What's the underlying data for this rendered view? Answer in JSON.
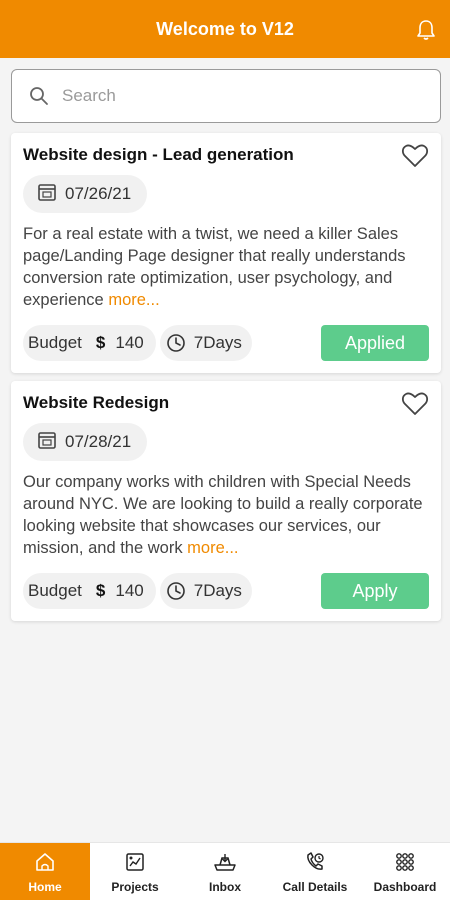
{
  "app": {
    "title": "Welcome to V12",
    "notification_icon": "bell-icon",
    "accent_color": "#f08a00",
    "success_color": "#5dcc8c"
  },
  "search": {
    "placeholder": "Search",
    "value": ""
  },
  "projects": [
    {
      "title": "Website design - Lead generation",
      "date": "07/26/21",
      "description": "For a real estate with a twist, we need a killer Sales page/Landing Page designer that really understands conversion rate optimization, user psychology, and experience",
      "more_label": "more...",
      "budget_label": "Budget",
      "currency": "$",
      "budget": "140",
      "duration": "7Days",
      "action_label": "Applied"
    },
    {
      "title": "Website Redesign",
      "date": "07/28/21",
      "description": "Our company works with children with Special Needs around NYC. We are looking to build a really corporate looking website that showcases our services, our mission, and the work",
      "more_label": "more...",
      "budget_label": "Budget",
      "currency": "$",
      "budget": "140",
      "duration": "7Days",
      "action_label": "Apply"
    }
  ],
  "nav": {
    "items": [
      {
        "label": "Home",
        "icon": "home-icon",
        "active": true
      },
      {
        "label": "Projects",
        "icon": "projects-icon",
        "active": false
      },
      {
        "label": "Inbox",
        "icon": "inbox-icon",
        "active": false
      },
      {
        "label": "Call Details",
        "icon": "call-details-icon",
        "active": false
      },
      {
        "label": "Dashboard",
        "icon": "dashboard-icon",
        "active": false
      }
    ]
  }
}
